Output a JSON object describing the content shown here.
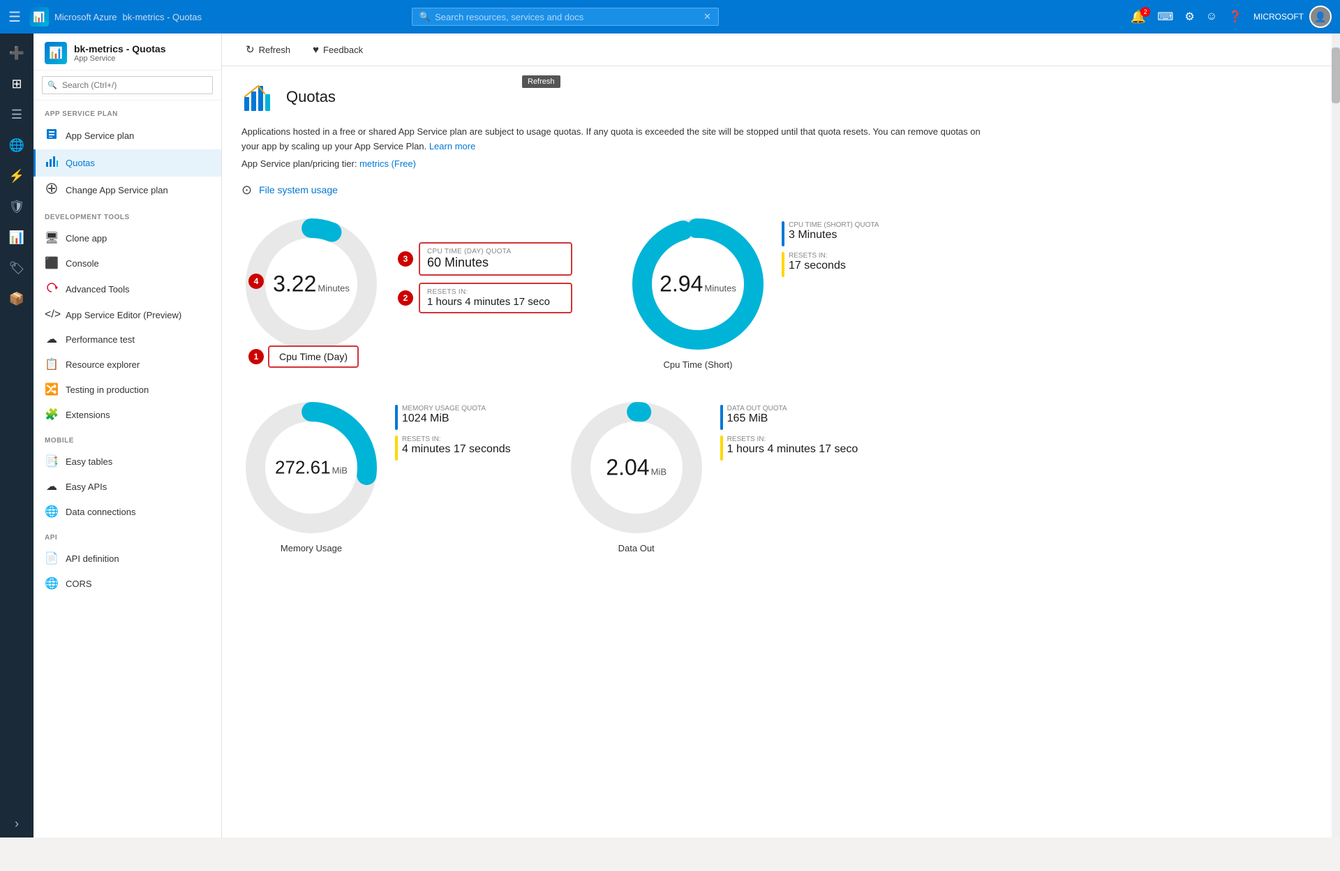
{
  "topnav": {
    "brand": "Microsoft Azure",
    "resource_path": "bk-metrics - Quotas",
    "search_placeholder": "Search resources, services and docs",
    "notif_count": "2",
    "user_label": "MICROSOFT"
  },
  "sidebar": {
    "app_title": "bk-metrics - Quotas",
    "app_subtitle": "App Service",
    "search_placeholder": "Search (Ctrl+/)",
    "sections": [
      {
        "label": "APP SERVICE PLAN",
        "items": [
          {
            "id": "app-service-plan",
            "icon": "📄",
            "label": "App Service plan"
          },
          {
            "id": "quotas",
            "icon": "📊",
            "label": "Quotas",
            "active": true
          },
          {
            "id": "change-plan",
            "icon": "🔧",
            "label": "Change App Service plan"
          }
        ]
      },
      {
        "label": "DEVELOPMENT TOOLS",
        "items": [
          {
            "id": "clone-app",
            "icon": "🖥",
            "label": "Clone app"
          },
          {
            "id": "console",
            "icon": "⬛",
            "label": "Console"
          },
          {
            "id": "advanced-tools",
            "icon": "🔑",
            "label": "Advanced Tools"
          },
          {
            "id": "app-service-editor",
            "icon": "⚙",
            "label": "App Service Editor (Preview)"
          },
          {
            "id": "performance-test",
            "icon": "☁",
            "label": "Performance test"
          },
          {
            "id": "resource-explorer",
            "icon": "📋",
            "label": "Resource explorer"
          },
          {
            "id": "testing-in-production",
            "icon": "🔀",
            "label": "Testing in production"
          },
          {
            "id": "extensions",
            "icon": "🧩",
            "label": "Extensions"
          }
        ]
      },
      {
        "label": "MOBILE",
        "items": [
          {
            "id": "easy-tables",
            "icon": "📑",
            "label": "Easy tables"
          },
          {
            "id": "easy-apis",
            "icon": "☁",
            "label": "Easy APIs"
          },
          {
            "id": "data-connections",
            "icon": "🌐",
            "label": "Data connections"
          }
        ]
      },
      {
        "label": "API",
        "items": [
          {
            "id": "api-definition",
            "icon": "📄",
            "label": "API definition"
          },
          {
            "id": "cors",
            "icon": "🌐",
            "label": "CORS"
          }
        ]
      }
    ]
  },
  "toolbar": {
    "refresh_label": "Refresh",
    "feedback_label": "Feedback",
    "refresh_tooltip": "Refresh"
  },
  "page": {
    "title": "Quotas",
    "description": "Applications hosted in a free or shared App Service plan are subject to usage quotas. If any quota is exceeded the site will be stopped until that quota resets. You can remove quotas on your app by scaling up your App Service Plan.",
    "learn_more_label": "Learn more",
    "tier_label": "App Service plan/pricing tier:",
    "tier_link": "metrics (Free)",
    "section_label": "File system usage"
  },
  "charts": [
    {
      "id": "cpu-day",
      "label": "Cpu Time (Day)",
      "value": "3.22",
      "unit": "Minutes",
      "fill_pct": 5.4,
      "color": "#00b4d8",
      "quota_label": "CPU TIME (DAY) QUOTA",
      "quota_value": "60 Minutes",
      "resets_label": "RESETS IN:",
      "resets_value": "1 hours 4 minutes 17 seco",
      "callout_num": "1",
      "quota_num": "3",
      "resets_num": "2",
      "value_num": "4",
      "show_callouts": true
    },
    {
      "id": "cpu-short",
      "label": "Cpu Time (Short)",
      "value": "2.94",
      "unit": "Minutes",
      "fill_pct": 98,
      "color": "#00b4d8",
      "quota_label": "CPU TIME (SHORT) QUOTA",
      "quota_value": "3 Minutes",
      "resets_label": "RESETS IN:",
      "resets_value": "17 seconds",
      "show_callouts": false
    },
    {
      "id": "memory",
      "label": "Memory Usage",
      "value": "272.61",
      "unit": "MiB",
      "fill_pct": 27,
      "color": "#00b4d8",
      "quota_label": "MEMORY USAGE QUOTA",
      "quota_value": "1024 MiB",
      "resets_label": "RESETS IN:",
      "resets_value": "4 minutes 17 seconds",
      "show_callouts": false
    },
    {
      "id": "data-out",
      "label": "Data Out",
      "value": "2.04",
      "unit": "MiB",
      "fill_pct": 1.2,
      "color": "#00b4d8",
      "quota_label": "DATA OUT QUOTA",
      "quota_value": "165 MiB",
      "resets_label": "RESETS IN:",
      "resets_value": "1 hours 4 minutes 17 seco",
      "show_callouts": false
    }
  ]
}
